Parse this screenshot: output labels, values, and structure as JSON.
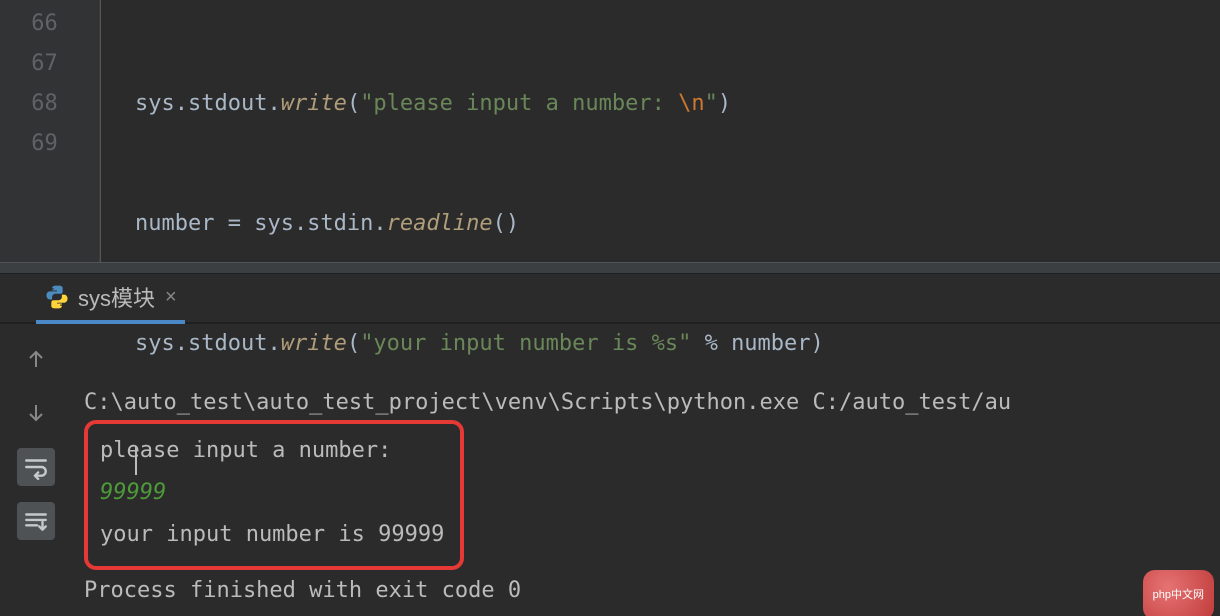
{
  "editor": {
    "lines": [
      66,
      67,
      68,
      69
    ],
    "code": {
      "l66": {
        "a": "sys.stdout.",
        "m": "write",
        "b": "(",
        "s1": "\"please input a number: ",
        "esc": "\\n",
        "s2": "\"",
        "c": ")"
      },
      "l67": {
        "a": "number = sys.stdin.",
        "m": "readline",
        "b": "()"
      },
      "l68": {
        "a": "sys.stdout.",
        "m": "write",
        "b": "(",
        "s1": "\"your input number is %s\"",
        "c": " % number)"
      }
    }
  },
  "console": {
    "tab_label": "sys模块",
    "cmd": "C:\\auto_test\\auto_test_project\\venv\\Scripts\\python.exe C:/auto_test/au",
    "out1": "please input a number:",
    "input": "99999",
    "out2": "your input number is 99999",
    "finished": "Process finished with exit code 0"
  },
  "icons": {
    "python": "python-icon",
    "close": "×",
    "arrow_up": "↑",
    "arrow_down": "↓",
    "wrap": "soft-wrap-icon",
    "scroll_end": "scroll-to-end-icon"
  },
  "watermark": "php中文网"
}
